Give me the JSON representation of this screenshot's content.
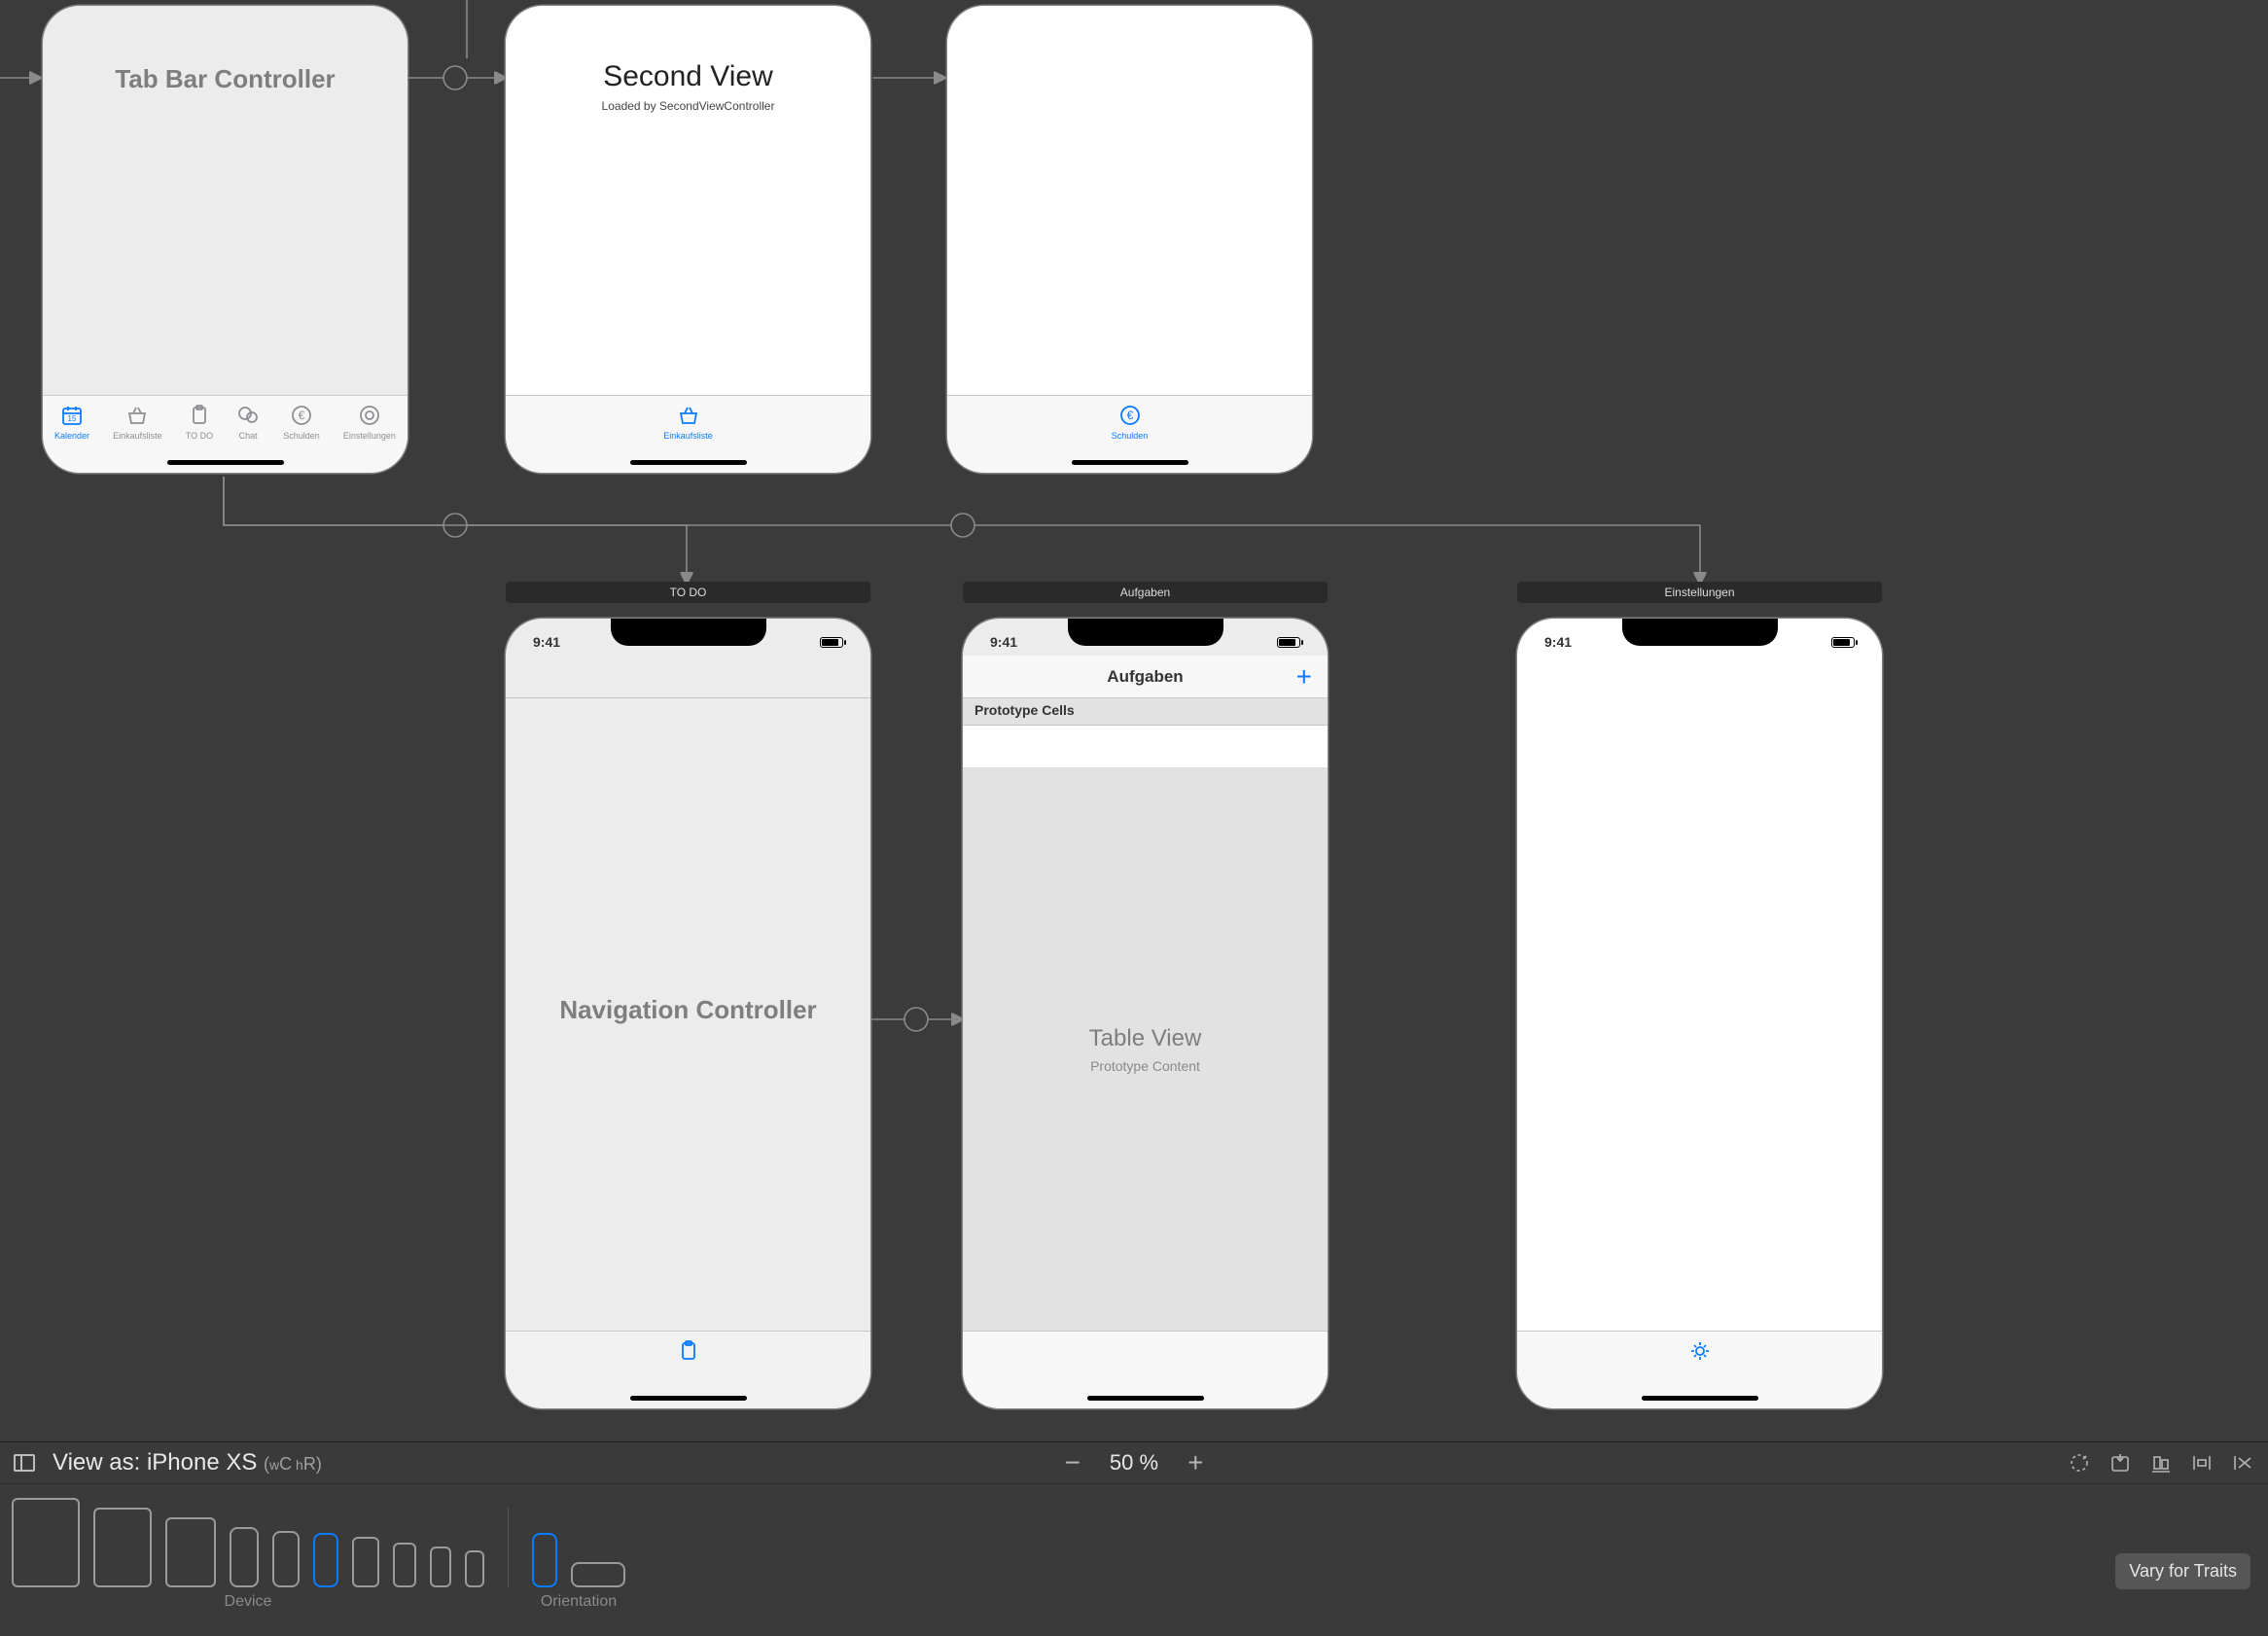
{
  "scenes": {
    "tabbar_controller": {
      "title": "Tab Bar Controller",
      "tabs": [
        {
          "label": "Kalender"
        },
        {
          "label": "Einkaufsliste"
        },
        {
          "label": "TO DO"
        },
        {
          "label": "Chat"
        },
        {
          "label": "Schulden"
        },
        {
          "label": "Einstellungen"
        }
      ]
    },
    "second_view": {
      "title": "Second View",
      "subtitle": "Loaded by SecondViewController",
      "tab_label": "Einkaufsliste"
    },
    "schulden": {
      "tab_label": "Schulden"
    },
    "todo_nav": {
      "scene_label": "TO DO",
      "title": "Navigation Controller",
      "status_time": "9:41"
    },
    "aufgaben": {
      "scene_label": "Aufgaben",
      "nav_title": "Aufgaben",
      "add_symbol": "+",
      "section_header": "Prototype Cells",
      "placeholder_title": "Table View",
      "placeholder_subtitle": "Prototype Content",
      "status_time": "9:41"
    },
    "einstellungen": {
      "scene_label": "Einstellungen",
      "status_time": "9:41"
    }
  },
  "bottombar": {
    "viewas_label": "View as: iPhone XS",
    "size_prefix": "(",
    "size_w_lo": "w",
    "size_w_hi": "C",
    "size_h_lo": " h",
    "size_h_hi": "R",
    "size_suffix": ")",
    "zoom_value": "50 %",
    "device_label": "Device",
    "orientation_label": "Orientation",
    "vary_label": "Vary for Traits"
  }
}
